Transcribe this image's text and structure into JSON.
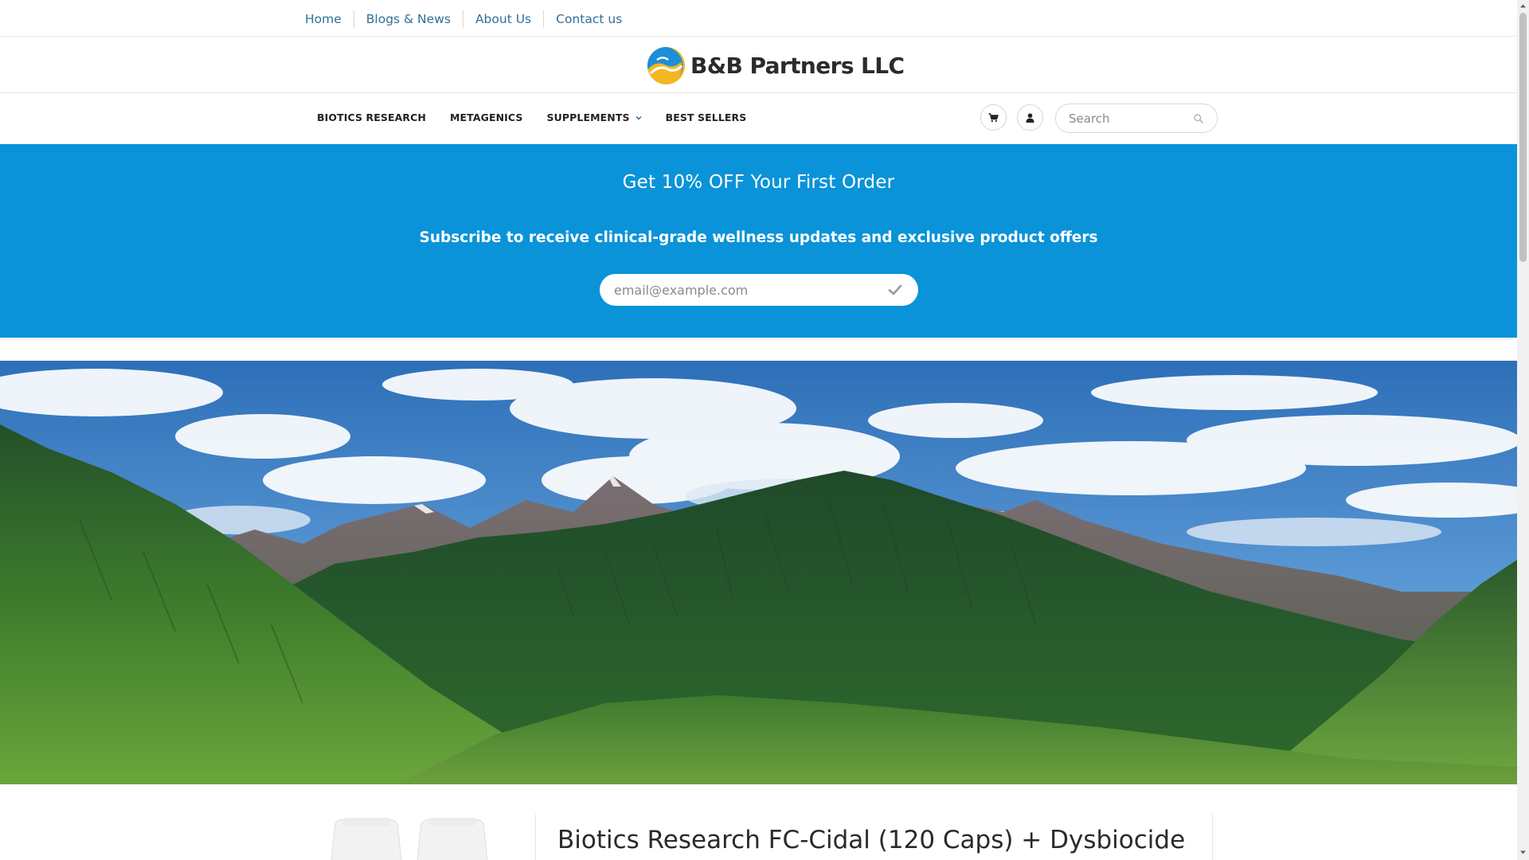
{
  "top_nav": {
    "items": [
      {
        "label": "Home"
      },
      {
        "label": "Blogs & News"
      },
      {
        "label": "About Us"
      },
      {
        "label": "Contact us"
      }
    ]
  },
  "brand": {
    "name": "B&B Partners LLC",
    "logo_icon": "swirl-logo-icon",
    "colors": {
      "logo_blue": "#1d8ed8",
      "logo_yellow": "#f3b81f"
    }
  },
  "main_nav": {
    "items": [
      {
        "label": "BIOTICS RESEARCH"
      },
      {
        "label": "METAGENICS"
      },
      {
        "label": "SUPPLEMENTS",
        "has_dropdown": true
      },
      {
        "label": "BEST SELLERS"
      }
    ],
    "cart_icon": "cart-icon",
    "account_icon": "user-icon",
    "search": {
      "placeholder": "Search",
      "value": ""
    }
  },
  "promo": {
    "heading": "Get 10% OFF Your First Order",
    "subheading": "Subscribe to receive clinical-grade wellness updates and exclusive product offers",
    "email": {
      "placeholder": "email@example.com",
      "value": ""
    },
    "submit_icon": "checkmark-icon",
    "background": "#0a93d8"
  },
  "hero": {
    "image": "mountain-valley-landscape"
  },
  "product": {
    "title": "Biotics Research FC-Cidal (120 Caps) + Dysbiocide"
  }
}
